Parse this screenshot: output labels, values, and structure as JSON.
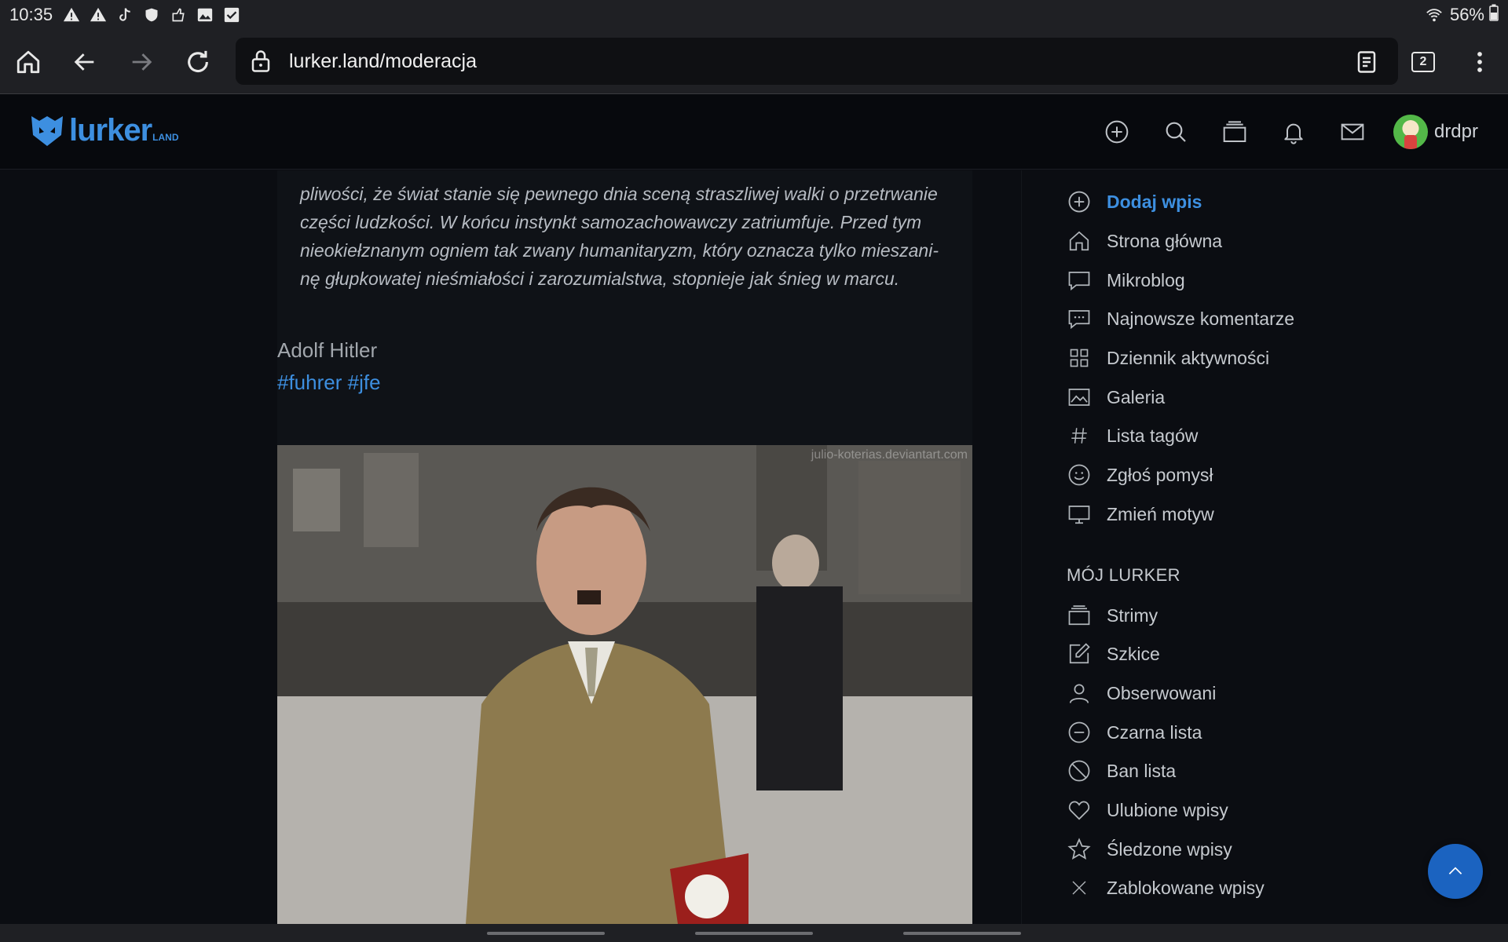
{
  "status_bar": {
    "time": "10:35",
    "battery": "56%",
    "icons": [
      "warning-icon",
      "warning-icon",
      "tiktok-icon",
      "shield-icon",
      "share-icon",
      "image-icon",
      "check-box-icon",
      "wifi-icon",
      "battery-icon"
    ]
  },
  "browser": {
    "url": "lurker.land/moderacja",
    "tab_count": "2"
  },
  "site": {
    "logo_text": "lurker",
    "logo_sub": "LAND",
    "username": "drdpr",
    "accent": "#3d8fe0"
  },
  "post": {
    "quote_lines": [
      "pliwości, że świat stanie się pewnego dnia sceną straszliwej walki o przetrwanie",
      "części ludzkości. W końcu instynkt samozachowawczy zatriumfuje. Przed tym",
      "nieokiełznanym ogniem tak zwany humanitaryzm, który oznacza tylko mieszani-",
      "nę głupkowatej nieśmiałości i zarozumialstwa, stopnieje jak śnieg w marcu."
    ],
    "author": "Adolf Hitler",
    "tags": [
      "#fuhrer",
      "#jfe"
    ],
    "image_watermark": "julio-koterias.deviantart.com"
  },
  "sidebar": {
    "menu": [
      {
        "label": "Dodaj wpis",
        "icon": "plus-circle-icon",
        "active": true
      },
      {
        "label": "Strona główna",
        "icon": "home-icon"
      },
      {
        "label": "Mikroblog",
        "icon": "chat-bubble-icon"
      },
      {
        "label": "Najnowsze komentarze",
        "icon": "comment-icon"
      },
      {
        "label": "Dziennik aktywności",
        "icon": "grid-icon"
      },
      {
        "label": "Galeria",
        "icon": "gallery-icon"
      },
      {
        "label": "Lista tagów",
        "icon": "hash-icon"
      },
      {
        "label": "Zgłoś pomysł",
        "icon": "smile-icon"
      },
      {
        "label": "Zmień motyw",
        "icon": "monitor-icon"
      }
    ],
    "section_title": "MÓJ LURKER",
    "my_menu": [
      {
        "label": "Strimy",
        "icon": "layers-icon"
      },
      {
        "label": "Szkice",
        "icon": "edit-icon"
      },
      {
        "label": "Obserwowani",
        "icon": "user-icon"
      },
      {
        "label": "Czarna lista",
        "icon": "minus-circle-icon"
      },
      {
        "label": "Ban lista",
        "icon": "ban-icon"
      },
      {
        "label": "Ulubione wpisy",
        "icon": "heart-icon"
      },
      {
        "label": "Śledzone wpisy",
        "icon": "star-icon"
      },
      {
        "label": "Zablokowane wpisy",
        "icon": "x-icon"
      }
    ]
  }
}
